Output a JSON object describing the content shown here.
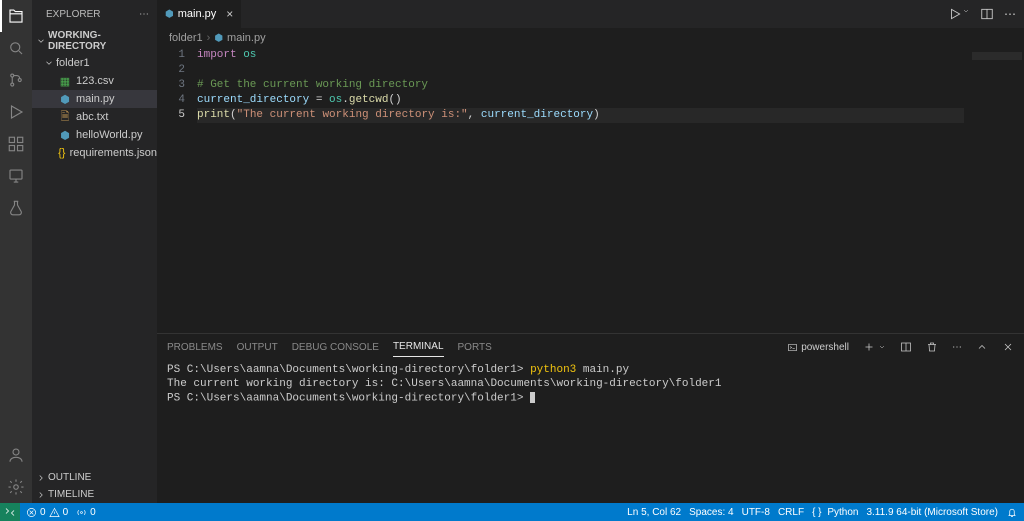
{
  "sidebar": {
    "title": "EXPLORER",
    "workspace": "WORKING-DIRECTORY",
    "tree": {
      "folder": "folder1",
      "files": [
        "123.csv",
        "main.py",
        "abc.txt",
        "helloWorld.py",
        "requirements.json"
      ]
    },
    "outline": "OUTLINE",
    "timeline": "TIMELINE"
  },
  "tabs": {
    "active": "main.py"
  },
  "breadcrumb": {
    "seg1": "folder1",
    "seg2": "main.py"
  },
  "code": {
    "lines": [
      "1",
      "2",
      "3",
      "4",
      "5"
    ],
    "l1_kw": "import",
    "l1_mod": " os",
    "l3_com": "# Get the current working directory",
    "l4_var": "current_directory ",
    "l4_eq": "= ",
    "l4_obj": "os",
    "l4_dot": ".",
    "l4_fn": "getcwd",
    "l4_par": "()",
    "l5_fn": "print",
    "l5_open": "(",
    "l5_str": "\"The current working directory is:\"",
    "l5_comma": ", ",
    "l5_arg": "current_directory",
    "l5_close": ")"
  },
  "panel": {
    "tabs": {
      "problems": "PROBLEMS",
      "output": "OUTPUT",
      "debug": "DEBUG CONSOLE",
      "terminal": "TERMINAL",
      "ports": "PORTS"
    },
    "shell": "powershell",
    "term": {
      "line1_prompt": "PS C:\\Users\\aamna\\Documents\\working-directory\\folder1> ",
      "line1_cmd": "python3",
      "line1_arg": " main.py",
      "line2": "The current working directory is: C:\\Users\\aamna\\Documents\\working-directory\\folder1",
      "line3_prompt": "PS C:\\Users\\aamna\\Documents\\working-directory\\folder1> "
    }
  },
  "status": {
    "errors": "0",
    "warnings": "0",
    "radio": "0",
    "lncol": "Ln 5, Col 62",
    "spaces": "Spaces: 4",
    "encoding": "UTF-8",
    "eol": "CRLF",
    "lang": "Python",
    "interpreter": "3.11.9 64-bit (Microsoft Store)"
  }
}
